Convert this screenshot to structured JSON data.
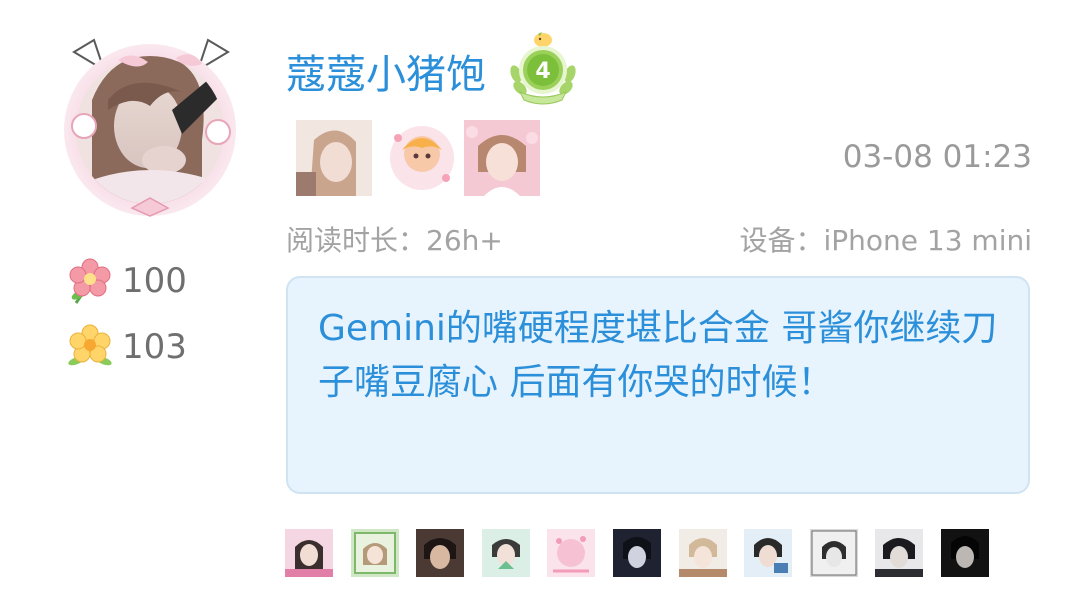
{
  "post": {
    "username": "蔻蔻小猪饱",
    "level": "4",
    "timestamp": "03-08 01:23",
    "reading_time": "阅读时长：26h+",
    "device": "设备：iPhone 13 mini",
    "comment": "Gemini的嘴硬程度堪比合金 哥酱你继续刀子嘴豆腐心 后面有你哭的时候！"
  },
  "stats": {
    "pink_flower_count": "100",
    "yellow_flower_count": "103"
  },
  "icons": {
    "pink_flower": "pink-flower-icon",
    "yellow_flower": "yellow-flower-icon",
    "level_badge": "level-badge-icon"
  },
  "colors": {
    "username": "#2b8fd9",
    "comment_text": "#2b8fd9",
    "bubble_bg": "#e8f4fd",
    "bubble_border": "#cfe3f2",
    "meta_text": "#a3a3a3",
    "badge_green": "#8fc94a"
  },
  "reactor_count": 11
}
